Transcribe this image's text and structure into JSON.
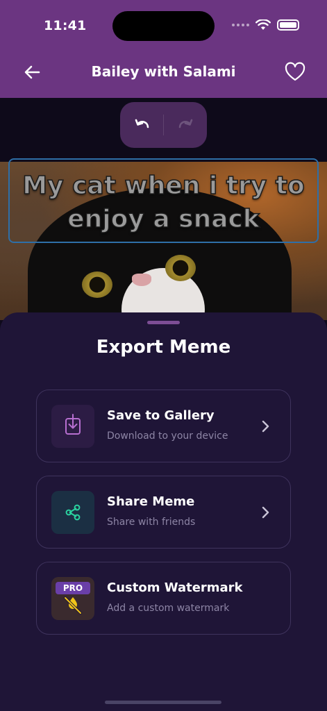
{
  "status_bar": {
    "time": "11:41"
  },
  "nav": {
    "title": "Bailey with Salami",
    "back_icon": "arrow-left-icon",
    "favorite_icon": "heart-icon"
  },
  "editor": {
    "caption_lines": [
      "My cat when i try to",
      "enjoy a snack"
    ]
  },
  "export_sheet": {
    "title": "Export Meme",
    "options": [
      {
        "title": "Save to Gallery",
        "subtitle": "Download to your device",
        "icon": "download-icon"
      },
      {
        "title": "Share Meme",
        "subtitle": "Share with friends",
        "icon": "share-icon"
      },
      {
        "title": "Custom Watermark",
        "subtitle": "Add a custom watermark",
        "icon": "watermark-off-icon",
        "badge": "PRO"
      }
    ]
  },
  "colors": {
    "header": "#6b3581",
    "sheet": "#1f1537",
    "accent_purple": "#b76fd0",
    "share_green": "#2bd3a0",
    "warning_yellow": "#f0c419"
  }
}
